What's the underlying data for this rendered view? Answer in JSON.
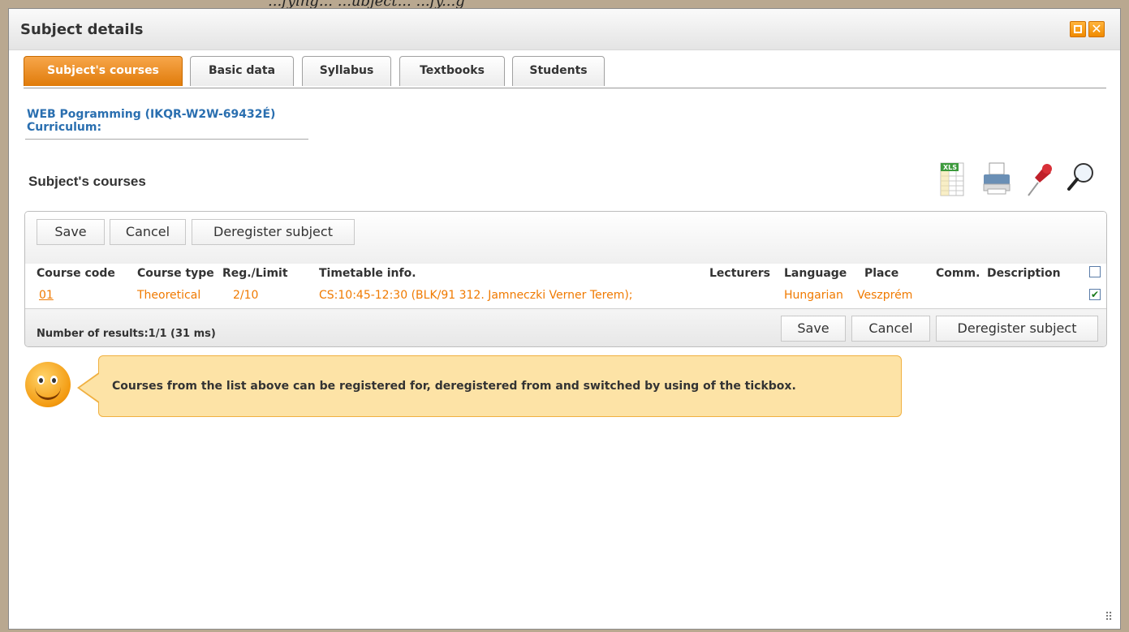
{
  "background_caption": "...fying... ...ubject... ...fy...g",
  "window": {
    "title": "Subject details"
  },
  "tabs": [
    {
      "label": "Subject's courses",
      "active": true
    },
    {
      "label": "Basic data",
      "active": false
    },
    {
      "label": "Syllabus",
      "active": false
    },
    {
      "label": "Textbooks",
      "active": false
    },
    {
      "label": "Students",
      "active": false
    }
  ],
  "subject": {
    "name": "WEB Pogramming (IKQR-W2W-69432É)",
    "curriculum_label": "Curriculum:"
  },
  "section": {
    "title": "Subject's courses"
  },
  "toolbar_icons": [
    "xls-export-icon",
    "printer-icon",
    "pushpin-icon",
    "magnifier-icon"
  ],
  "actions": {
    "save": "Save",
    "cancel": "Cancel",
    "deregister": "Deregister subject"
  },
  "table": {
    "headers": {
      "course_code": "Course code",
      "course_type": "Course type",
      "reg_limit": "Reg./Limit",
      "timetable": "Timetable info.",
      "lecturers": "Lecturers",
      "language": "Language",
      "place": "Place",
      "comm": "Comm.",
      "description": "Description"
    },
    "header_checkbox_checked": false,
    "rows": [
      {
        "course_code": "01",
        "course_type": "Theoretical",
        "reg_limit": "2/10",
        "timetable": "CS:10:45-12:30 (BLK/91 312. Jamneczki Verner Terem);",
        "lecturers": "",
        "language": "Hungarian",
        "place": "Veszprém",
        "comm": "",
        "description": "",
        "checked": true
      }
    ],
    "results": "Number of results:1/1 (31 ms)"
  },
  "hint": {
    "text": "Courses from the list above can be registered for, deregistered from and switched by using of the tickbox."
  },
  "colors": {
    "accent": "#f07a00",
    "link": "#2a6fb0",
    "hint_bg": "#fde3a6"
  }
}
